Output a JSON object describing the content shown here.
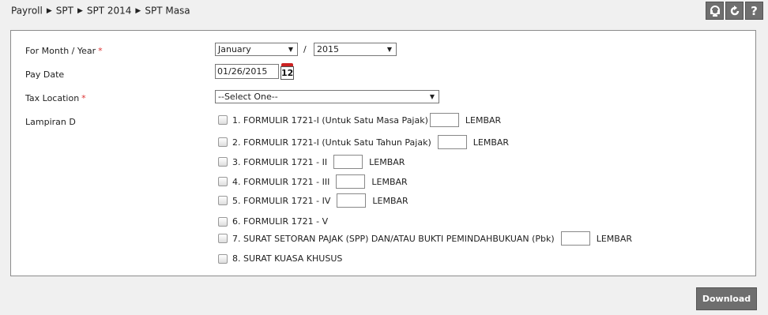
{
  "breadcrumb": [
    "Payroll",
    "SPT",
    "SPT 2014",
    "SPT Masa"
  ],
  "toolbar": {
    "help_label": "?"
  },
  "form": {
    "month_year_label": "For Month / Year",
    "required_mark": "*",
    "month_value": "January",
    "year_separator": "/",
    "year_value": "2015",
    "pay_date_label": "Pay Date",
    "pay_date_value": "01/26/2015",
    "calendar_day": "12",
    "tax_location_label": "Tax Location",
    "tax_location_value": "--Select One--",
    "lampiran_label": "Lampiran D",
    "unit_label": "LEMBAR",
    "items": [
      "1. FORMULIR 1721-I (Untuk Satu Masa Pajak)",
      "2. FORMULIR 1721-I (Untuk Satu Tahun Pajak)",
      "3. FORMULIR 1721 - II",
      "4. FORMULIR 1721 - III",
      "5. FORMULIR 1721 - IV",
      "6. FORMULIR 1721 - V",
      "7. SURAT SETORAN PAJAK (SPP) DAN/ATAU BUKTI PEMINDAHBUKUAN (Pbk)",
      "8. SURAT KUASA KHUSUS"
    ]
  },
  "download_label": "Download",
  "colors": {
    "button_bg": "#6e6e6e",
    "required": "#dd3333"
  }
}
